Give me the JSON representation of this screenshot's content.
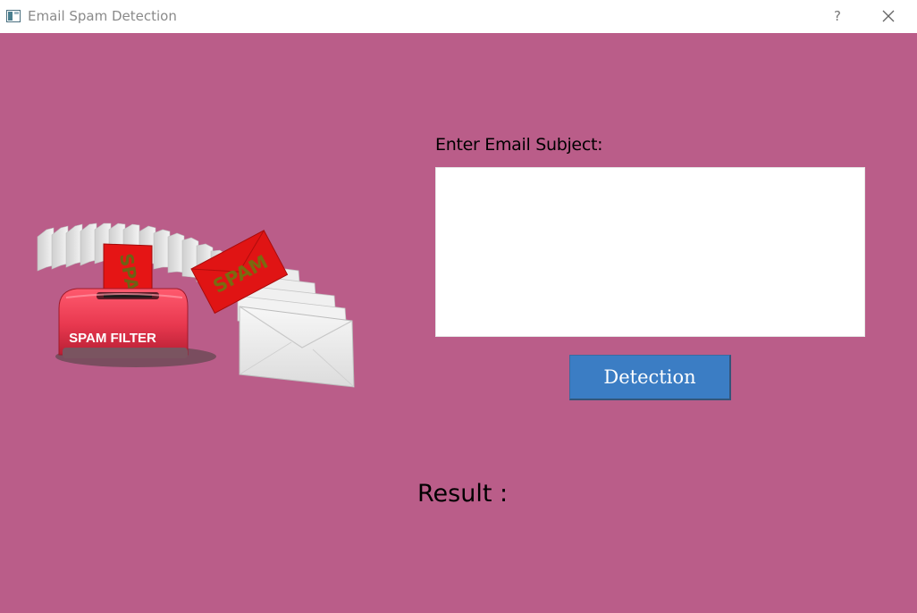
{
  "window": {
    "title": "Email Spam Detection",
    "help_label": "?"
  },
  "colors": {
    "background": "#ba5d89",
    "button": "#3b7dc4",
    "button_text": "#ffffff"
  },
  "illustration": {
    "filter_label": "SPAM FILTER",
    "envelope_label": "SPAM",
    "icon": "spam-filter-illustration"
  },
  "form": {
    "subject_label": "Enter Email Subject:",
    "subject_value": "",
    "detect_button_label": "Detection"
  },
  "result": {
    "label": "Result :"
  }
}
